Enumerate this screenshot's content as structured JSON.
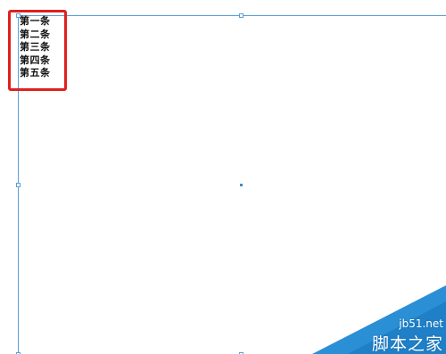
{
  "text_frame": {
    "lines": [
      "第一条",
      "第二条",
      "第三条",
      "第四条",
      "第五条"
    ]
  },
  "highlight": {
    "color": "#e02020"
  },
  "selection": {
    "color": "#5aa0d8"
  },
  "watermark": {
    "site": "jb51.net",
    "name": "脚本之家",
    "color": "#2b8fd6"
  }
}
